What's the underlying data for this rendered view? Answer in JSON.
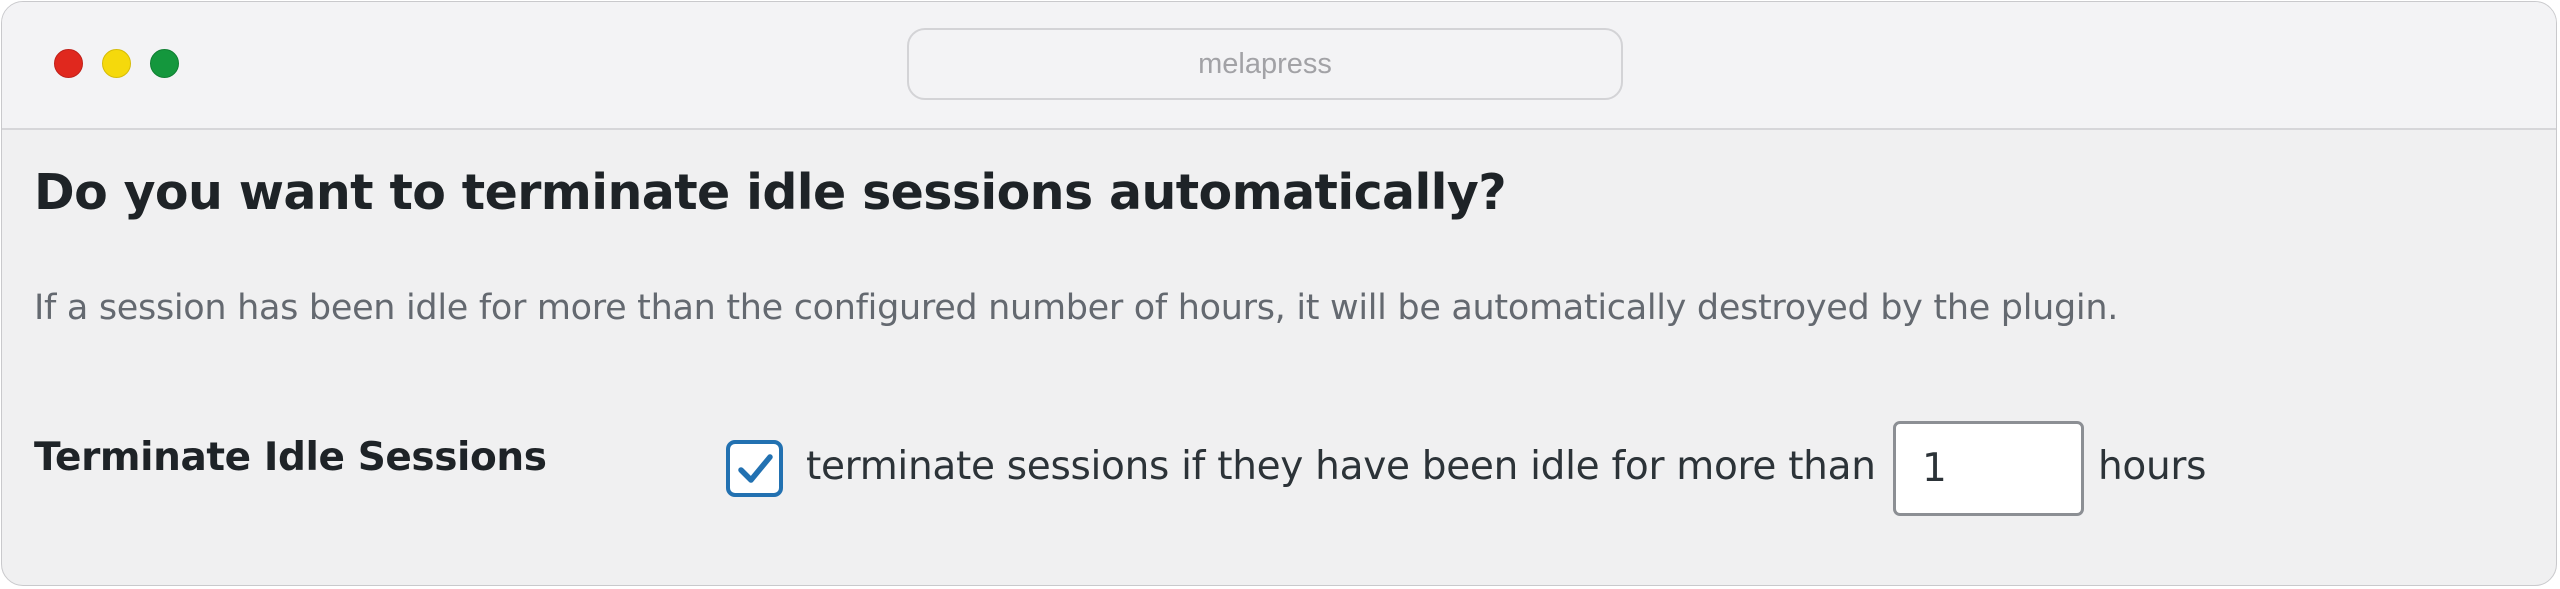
{
  "window": {
    "address_bar": "melapress",
    "controls": {
      "close_icon": "red-circle",
      "minimize_icon": "yellow-circle",
      "zoom_icon": "green-circle"
    }
  },
  "section": {
    "heading": "Do you want to terminate idle sessions automatically?",
    "description": "If a session has been idle for more than the configured number of hours, it will be automatically destroyed by the plugin."
  },
  "setting": {
    "label": "Terminate Idle Sessions",
    "checkbox_checked": true,
    "checkbox_icon": "checkmark-icon",
    "text_before": "terminate sessions if they have been idle for more than",
    "hours_value": "1",
    "text_after": "hours"
  },
  "colors": {
    "accent": "#2271b1",
    "heading": "#1e2327",
    "muted_text": "#646970",
    "background": "#f0f0f1"
  }
}
